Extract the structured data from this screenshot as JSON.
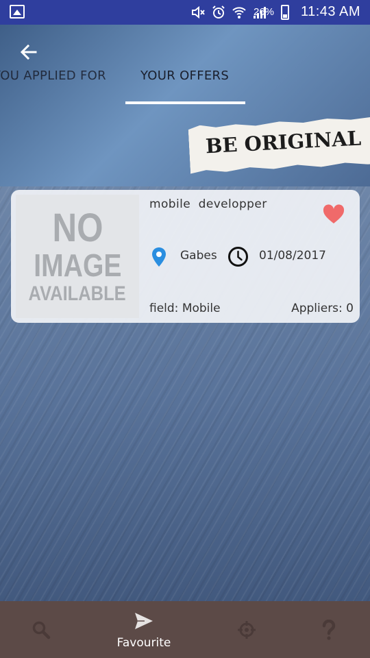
{
  "status_bar": {
    "battery_percent": "26%",
    "time": "11:43 AM"
  },
  "header": {
    "tabs": [
      {
        "label": "YOU APPLIED FOR",
        "selected": false
      },
      {
        "label": "YOUR OFFERS",
        "selected": true
      }
    ],
    "banner_text": "BE ORIGINAL"
  },
  "offers": [
    {
      "image_placeholder": [
        "NO",
        "IMAGE",
        "AVAILABLE"
      ],
      "title": "mobile  developper",
      "location": "Gabes",
      "date": "01/08/2017",
      "field": "field: Mobile",
      "appliers": "Appliers: 0",
      "favourite": true
    }
  ],
  "bottom_nav": {
    "items": [
      {
        "icon": "search-icon",
        "label": ""
      },
      {
        "icon": "send-icon",
        "label": "Favourite",
        "active": true
      },
      {
        "icon": "target-icon",
        "label": ""
      },
      {
        "icon": "help-icon",
        "label": ""
      }
    ]
  },
  "colors": {
    "status_bar": "#2f3e9e",
    "bottom_nav": "#5c4a47",
    "heart": "#f06a6a",
    "location_pin": "#2a8ee0"
  }
}
